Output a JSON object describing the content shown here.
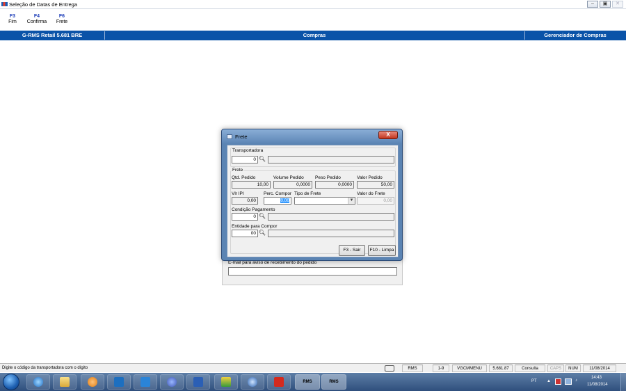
{
  "window": {
    "title": "Seleção de Datas de Entrega",
    "controls": [
      "‒",
      "▣",
      "✕"
    ]
  },
  "toolbar": {
    "keys": [
      {
        "key": "F3",
        "label": "Fim"
      },
      {
        "key": "F4",
        "label": "Confirma"
      },
      {
        "key": "F6",
        "label": "Frete"
      }
    ]
  },
  "header": {
    "app_version": "G-RMS Retail 5.681 BRE",
    "module": "Compras",
    "manager": "Gerenciador de Compras"
  },
  "background_panel": {
    "email_label": "E-mail para aviso de recebimento do pedido",
    "email_value": ""
  },
  "dialog": {
    "title": "Frete",
    "close": "X",
    "transportadora": {
      "label": "Transportadora",
      "code": "0",
      "name": ""
    },
    "frete": {
      "group_label": "Frete",
      "qtd_pedido": {
        "label": "Qtd. Pedido",
        "value": "10,00"
      },
      "volume_pedido": {
        "label": "Volume Pedido",
        "value": "0,0000"
      },
      "peso_pedido": {
        "label": "Peso Pedido",
        "value": "0,0000"
      },
      "valor_pedido": {
        "label": "Valor Pedido",
        "value": "50,00"
      },
      "vlr_ipi": {
        "label": "Vlr IPI",
        "value": "0,00"
      },
      "perc_compor": {
        "label": "Perc. Compor",
        "value": "0,00"
      },
      "tipo_frete": {
        "label": "Tipo de Frete",
        "value": ""
      },
      "valor_frete": {
        "label": "Valor do Frete",
        "value": "0,00"
      },
      "condicao_pagamento": {
        "label": "Condição Pagamento",
        "code": "0",
        "name": ""
      },
      "entidade_compor": {
        "label": "Entidade para Compor",
        "code": "00",
        "name": ""
      }
    },
    "buttons": {
      "sair": "F3 - Sair",
      "limpa": "F10 - Limpa"
    }
  },
  "statusbar": {
    "message": "Digite o código da transportadora com o dígito",
    "cells": [
      "RMS",
      "1-9",
      "VGCMMENU",
      "5.681.87",
      "Consulta",
      "CAPS",
      "NUM",
      "11/08/2014"
    ]
  },
  "taskbar": {
    "apps": [
      "",
      "",
      "",
      "",
      "",
      "",
      "",
      "",
      "",
      "",
      "RMS",
      "RMS"
    ],
    "tray": {
      "lang": "PT",
      "time": "14:43",
      "date": "11/08/2014"
    }
  }
}
